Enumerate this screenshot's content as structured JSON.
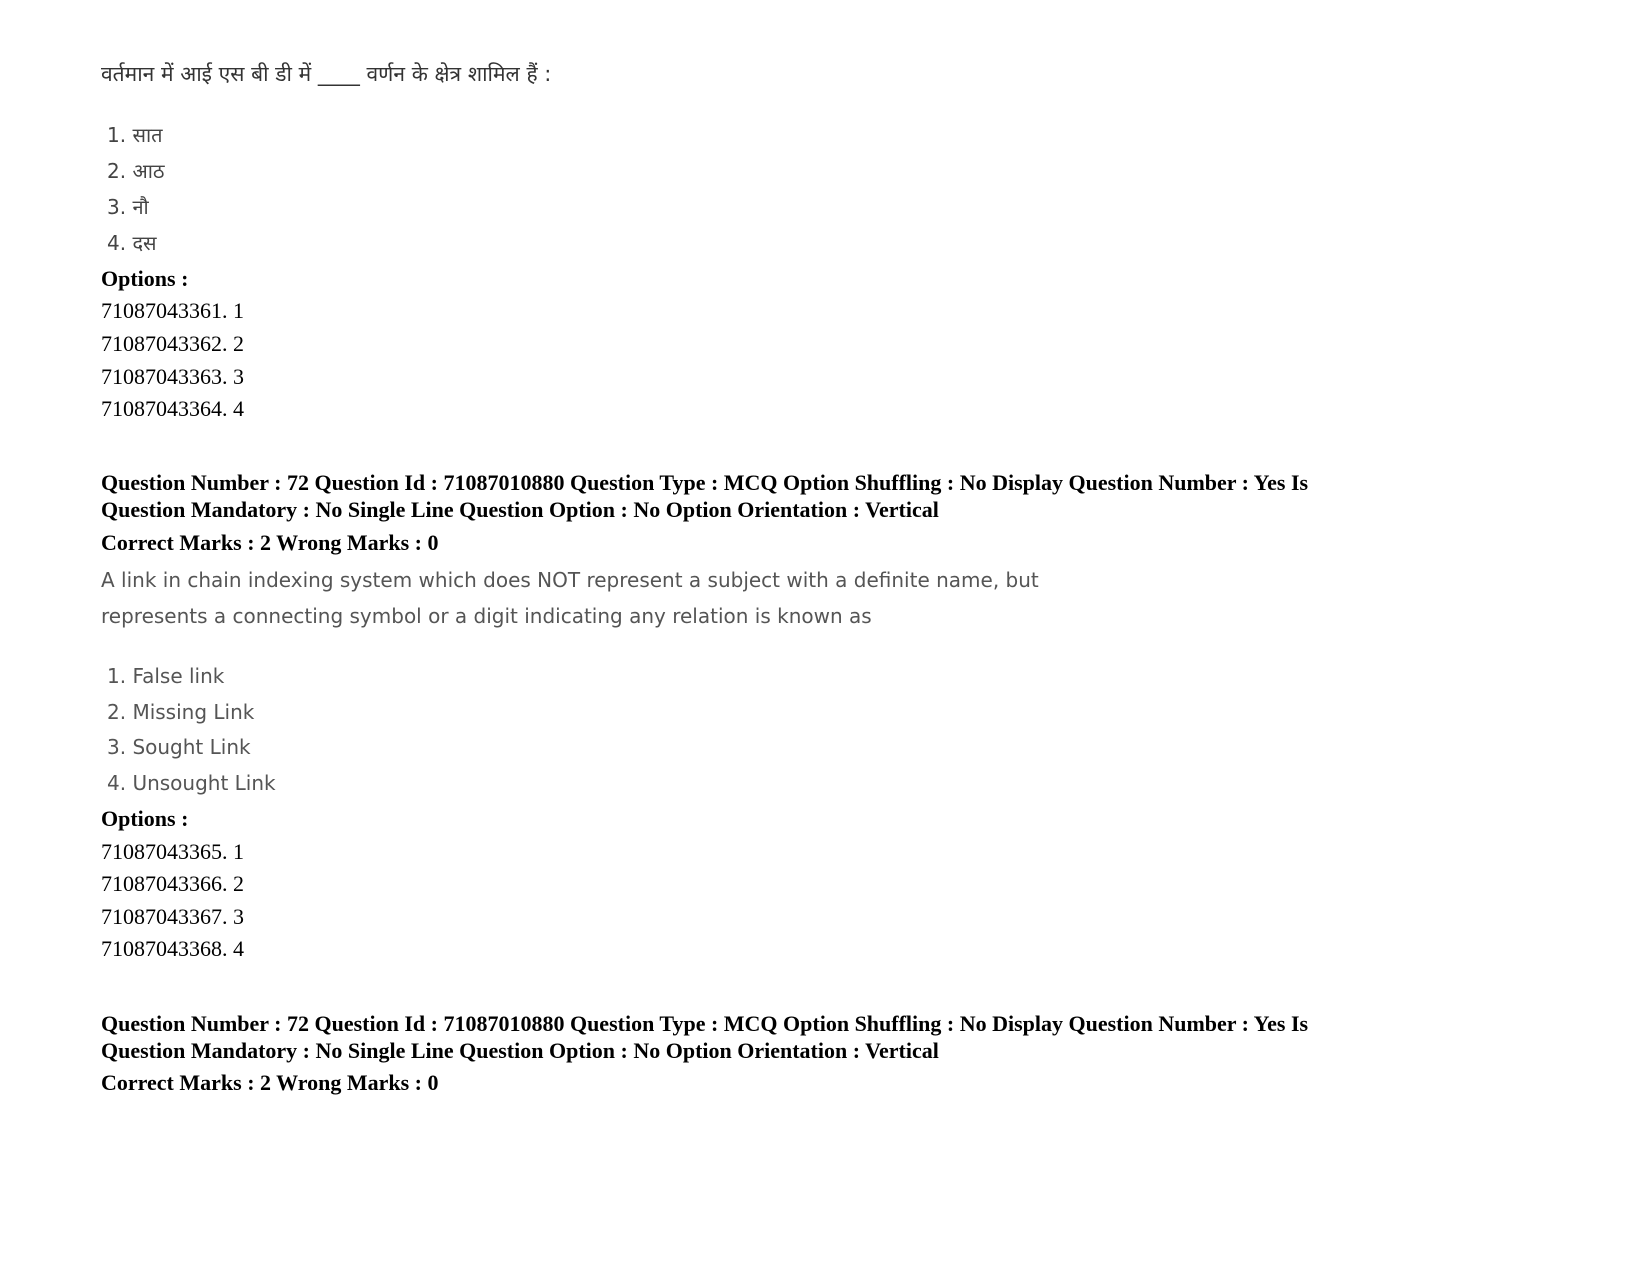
{
  "q71": {
    "text": "वर्तमान में आई एस बी डी में ____ वर्णन के क्षेत्र शामिल हैं :",
    "choices": [
      "1. सात",
      "2. आठ",
      "3. नौ",
      "4. दस"
    ],
    "options_label": "Options :",
    "options": [
      "71087043361. 1",
      "71087043362. 2",
      "71087043363. 3",
      "71087043364. 4"
    ]
  },
  "q72": {
    "meta_line1": "Question Number : 72 Question Id : 71087010880 Question Type : MCQ Option Shuffling : No Display Question Number : Yes Is",
    "meta_line2": "Question Mandatory : No Single Line Question Option : No Option Orientation : Vertical",
    "marks": "Correct Marks : 2 Wrong Marks : 0",
    "text_line1": "A link in chain indexing system which does NOT represent a subject with a definite name, but",
    "text_line2": "represents a connecting symbol or a digit indicating any relation is known as",
    "choices": [
      "1. False link",
      "2. Missing Link",
      "3. Sought Link",
      "4. Unsought Link"
    ],
    "options_label": "Options :",
    "options": [
      "71087043365. 1",
      "71087043366. 2",
      "71087043367. 3",
      "71087043368. 4"
    ]
  },
  "q72b": {
    "meta_line1": "Question Number : 72 Question Id : 71087010880 Question Type : MCQ Option Shuffling : No Display Question Number : Yes Is",
    "meta_line2": "Question Mandatory : No Single Line Question Option : No Option Orientation : Vertical",
    "marks": "Correct Marks : 2 Wrong Marks : 0"
  }
}
